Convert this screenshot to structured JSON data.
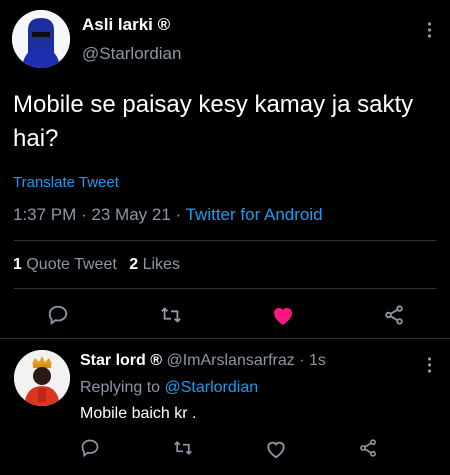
{
  "tweet": {
    "author_name": "Asli larki ®",
    "handle": "@Starlordian",
    "text": "Mobile se paisay kesy kamay ja sakty hai?",
    "translate": "Translate Tweet",
    "time_date": "1:37 PM · 23 May 21 · ",
    "source": "Twitter for Android",
    "stats": {
      "quote_count": "1",
      "quote_label": " Quote Tweet",
      "like_count": "2",
      "like_label": " Likes"
    }
  },
  "reply": {
    "author_name": "Star lord ®",
    "handle_time": " @ImArslansarfraz · 1s",
    "replying_prefix": "Replying to ",
    "replying_to": "@Starlordian",
    "text": "Mobile baich kr ."
  },
  "colors": {
    "accent": "#1d9bf0",
    "like": "#f91880",
    "muted": "#8b98a5",
    "divider": "#2f3336"
  },
  "icons": [
    "more-icon",
    "reply-icon",
    "retweet-icon",
    "heart-icon",
    "share-icon"
  ]
}
